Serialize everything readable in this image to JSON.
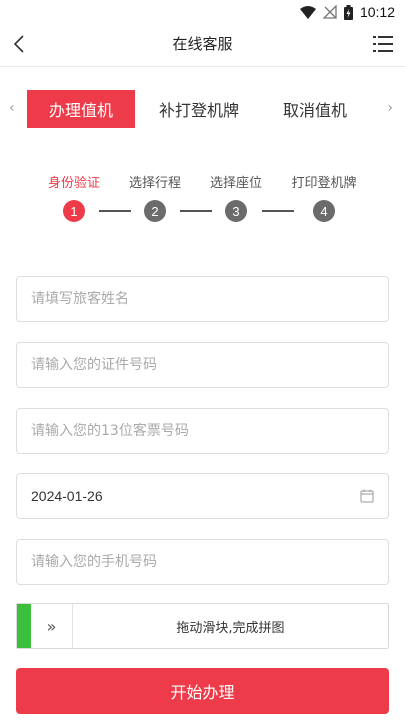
{
  "status_bar": {
    "time": "10:12"
  },
  "header": {
    "title": "在线客服"
  },
  "tabs": [
    {
      "label": "办理值机",
      "active": true
    },
    {
      "label": "补打登机牌",
      "active": false
    },
    {
      "label": "取消值机",
      "active": false
    }
  ],
  "steps": [
    {
      "label": "身份验证",
      "number": "1",
      "active": true
    },
    {
      "label": "选择行程",
      "number": "2",
      "active": false
    },
    {
      "label": "选择座位",
      "number": "3",
      "active": false
    },
    {
      "label": "打印登机牌",
      "number": "4",
      "active": false
    }
  ],
  "form": {
    "name_placeholder": "请填写旅客姓名",
    "id_placeholder": "请输入您的证件号码",
    "ticket_placeholder": "请输入您的13位客票号码",
    "date_value": "2024-01-26",
    "phone_placeholder": "请输入您的手机号码"
  },
  "slider": {
    "handle_glyph": "»",
    "text": "拖动滑块,完成拼图"
  },
  "submit_label": "开始办理",
  "colors": {
    "accent": "#ee3b4a",
    "slider_fill": "#3cbf3c"
  }
}
